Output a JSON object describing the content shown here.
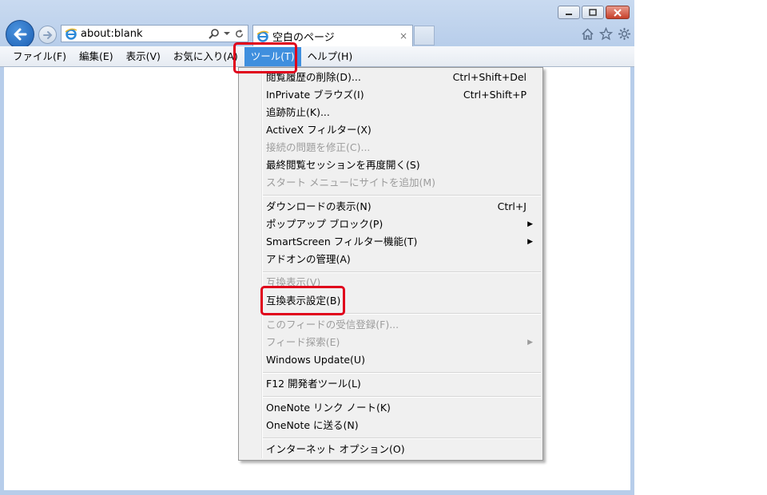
{
  "address": {
    "value": "about:blank"
  },
  "tab": {
    "title": "空白のページ",
    "close": "×"
  },
  "menubar": [
    {
      "label": "ファイル(F)"
    },
    {
      "label": "編集(E)"
    },
    {
      "label": "表示(V)"
    },
    {
      "label": "お気に入り(A)"
    },
    {
      "label": "ツール(T)"
    },
    {
      "label": "ヘルプ(H)"
    }
  ],
  "tools_menu": {
    "items": [
      {
        "label": "閲覧履歴の削除(D)...",
        "shortcut": "Ctrl+Shift+Del"
      },
      {
        "label": "InPrivate ブラウズ(I)",
        "shortcut": "Ctrl+Shift+P"
      },
      {
        "label": "追跡防止(K)...",
        "shortcut": ""
      },
      {
        "label": "ActiveX フィルター(X)",
        "shortcut": ""
      },
      {
        "label": "接続の問題を修正(C)...",
        "shortcut": ""
      },
      {
        "label": "最終閲覧セッションを再度開く(S)",
        "shortcut": ""
      },
      {
        "label": "スタート メニューにサイトを追加(M)",
        "shortcut": ""
      },
      {
        "label": "ダウンロードの表示(N)",
        "shortcut": "Ctrl+J"
      },
      {
        "label": "ポップアップ ブロック(P)",
        "shortcut": ""
      },
      {
        "label": "SmartScreen フィルター機能(T)",
        "shortcut": ""
      },
      {
        "label": "アドオンの管理(A)",
        "shortcut": ""
      },
      {
        "label": "互換表示(V)",
        "shortcut": ""
      },
      {
        "label": "互換表示設定(B)",
        "shortcut": ""
      },
      {
        "label": "このフィードの受信登録(F)...",
        "shortcut": ""
      },
      {
        "label": "フィード探索(E)",
        "shortcut": ""
      },
      {
        "label": "Windows Update(U)",
        "shortcut": ""
      },
      {
        "label": "F12 開発者ツール(L)",
        "shortcut": ""
      },
      {
        "label": "OneNote リンク ノート(K)",
        "shortcut": ""
      },
      {
        "label": "OneNote に送る(N)",
        "shortcut": ""
      },
      {
        "label": "インターネット オプション(O)",
        "shortcut": ""
      }
    ]
  },
  "colors": {
    "highlight": "#e0001b",
    "menu_active": "#3f8fde"
  }
}
